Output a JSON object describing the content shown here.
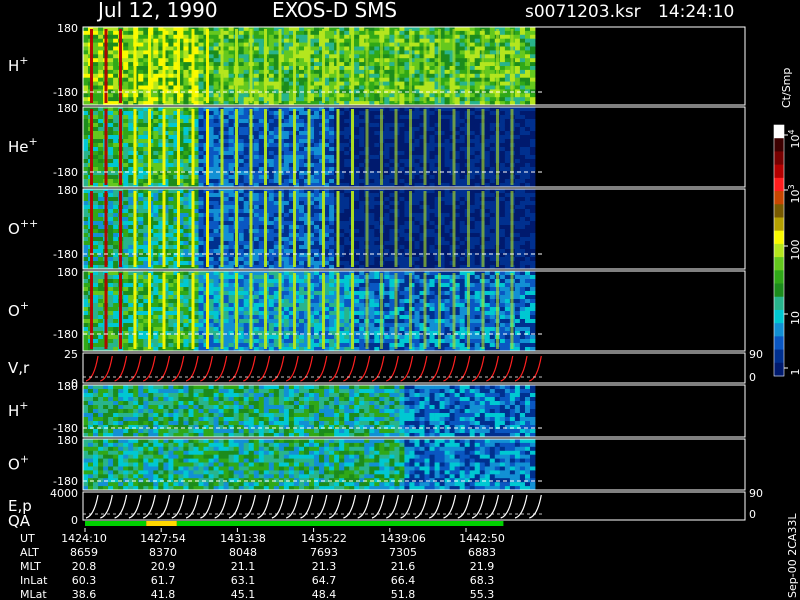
{
  "header": {
    "date": "Jul 12, 1990",
    "instrument": "EXOS-D SMS",
    "file": "s0071203.ksr",
    "time": "14:24:10"
  },
  "colorbar": {
    "unit": "Ct/Smp",
    "levels": [
      "1",
      "10",
      "100",
      "10",
      "10"
    ],
    "level_exps": [
      "",
      "",
      "",
      "3",
      "4"
    ],
    "colors": [
      "#001a6e",
      "#00308f",
      "#0a57c2",
      "#1290d4",
      "#00c8d2",
      "#28b48c",
      "#1c8c1c",
      "#30a818",
      "#64c81e",
      "#b4e61e",
      "#fafa00",
      "#b4a000",
      "#785a00",
      "#c84600",
      "#ff1e1e",
      "#b40000",
      "#780000",
      "#3c0000",
      "#ffffff"
    ]
  },
  "footer": {
    "stamp": "Sep-00 2CA33L",
    "row_labels": [
      "UT",
      "ALT",
      "MLT",
      "InLat",
      "MLat"
    ],
    "columns": [
      [
        "1424:10",
        "8659",
        "20.8",
        "60.3",
        "38.6"
      ],
      [
        "1427:54",
        "8370",
        "20.9",
        "61.7",
        "41.8"
      ],
      [
        "1431:38",
        "8048",
        "21.1",
        "63.1",
        "45.1"
      ],
      [
        "1435:22",
        "7693",
        "21.3",
        "64.7",
        "48.4"
      ],
      [
        "1439:06",
        "7305",
        "21.6",
        "66.4",
        "51.8"
      ],
      [
        "1442:50",
        "6883",
        "21.9",
        "68.3",
        "55.3"
      ]
    ]
  },
  "chart_data": [
    {
      "type": "heatmap",
      "panel": "H+",
      "label": "H",
      "charge": "+",
      "ylim": [
        -180,
        180
      ],
      "yticks": [
        "180",
        "-180"
      ],
      "time_range": [
        "1424:10",
        "1442:50"
      ],
      "data_end": "1444:40",
      "dominant": "green-yellow broadband, periodic spin stripes"
    },
    {
      "type": "heatmap",
      "panel": "He+",
      "label": "He",
      "charge": "+",
      "ylim": [
        -180,
        180
      ],
      "yticks": [
        "180",
        "-180"
      ],
      "time_range": [
        "1424:10",
        "1442:50"
      ],
      "data_end": "1444:40",
      "dominant": "blue background, red/yellow stripes early"
    },
    {
      "type": "heatmap",
      "panel": "O++",
      "label": "O",
      "charge": "++",
      "ylim": [
        -180,
        180
      ],
      "yticks": [
        "180",
        "-180"
      ],
      "time_range": [
        "1424:10",
        "1442:50"
      ],
      "data_end": "1444:40",
      "dominant": "blue background, yellow stripes early"
    },
    {
      "type": "heatmap",
      "panel": "O+",
      "label": "O",
      "charge": "+",
      "ylim": [
        -180,
        180
      ],
      "yticks": [
        "180",
        "-180"
      ],
      "time_range": [
        "1424:10",
        "1442:50"
      ],
      "data_end": "1444:40",
      "dominant": "blue/cyan background, yellow stripes"
    },
    {
      "type": "line",
      "panel": "V,r",
      "label": "V,r",
      "ylim": [
        0,
        25
      ],
      "yticks": [
        "25",
        "0"
      ],
      "right_ticks": [
        "90",
        "0"
      ],
      "series_color": "#ff2020"
    },
    {
      "type": "heatmap",
      "panel": "H+ (2)",
      "label": "H",
      "charge": "+",
      "ylim": [
        -180,
        180
      ],
      "yticks": [
        "180",
        "-180"
      ],
      "dominant": "green/cyan mixed"
    },
    {
      "type": "heatmap",
      "panel": "O+ (2)",
      "label": "O",
      "charge": "+",
      "ylim": [
        -180,
        180
      ],
      "yticks": [
        "180",
        "-180"
      ],
      "dominant": "green/cyan mixed"
    },
    {
      "type": "line",
      "panel": "E,p",
      "label": "E,p",
      "ylim": [
        0,
        4000
      ],
      "yticks": [
        "4000",
        "0"
      ],
      "right_ticks": [
        "90",
        "0"
      ],
      "series_color": "#ffffff"
    },
    {
      "type": "bar",
      "panel": "QA",
      "label": "QA",
      "segments": [
        {
          "from": "1424:10",
          "to": "1427:10",
          "color": "#00d000"
        },
        {
          "from": "1427:10",
          "to": "1428:40",
          "color": "#ffd700"
        },
        {
          "from": "1428:40",
          "to": "1444:40",
          "color": "#00d000"
        }
      ]
    }
  ]
}
